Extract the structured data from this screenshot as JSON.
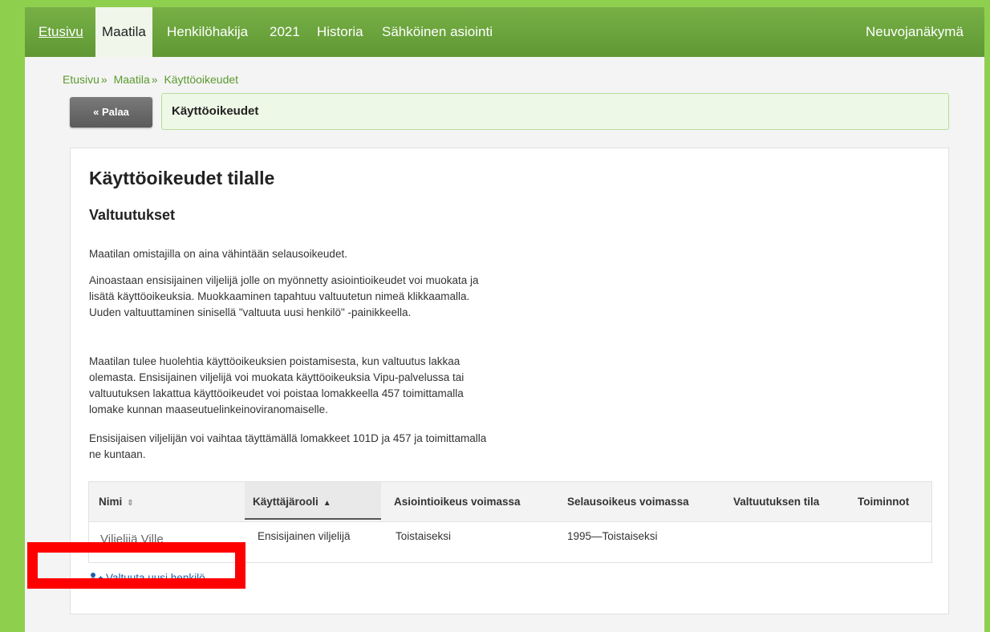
{
  "nav": {
    "items": [
      "Etusivu",
      "Maatila",
      "Henkilöhakija",
      "2021",
      "Historia",
      "Sähköinen asiointi"
    ],
    "right": "Neuvojanäkymä"
  },
  "breadcrumb": [
    "Etusivu",
    "Maatila",
    "Käyttöoikeudet"
  ],
  "back_button": "Palaa",
  "title_bar": "Käyttöoikeudet",
  "page": {
    "heading": "Käyttöoikeudet tilalle",
    "subheading": "Valtuutukset",
    "paragraphs": [
      "Maatilan omistajilla on aina vähintään selausoikeudet.",
      "Ainoastaan ensisijainen viljelijä jolle on myönnetty asiointioikeudet voi muokata ja lisätä käyttöoikeuksia. Muokkaaminen tapahtuu valtuutetun nimeä klikkaamalla. Uuden valtuuttaminen sinisellä \"valtuuta uusi henkilö\" -painikkeella.",
      "Maatilan tulee huolehtia käyttöoikeuksien poistamisesta, kun valtuutus lakkaa olemasta. Ensisijainen viljelijä voi muokata käyttöoikeuksia Vipu-palvelussa tai valtuutuksen lakattua käyttöoikeudet voi poistaa lomakkeella 457 toimittamalla lomake kunnan maaseutuelinkeinoviranomaiselle.",
      "Ensisijaisen viljelijän voi vaihtaa täyttämällä lomakkeet 101D ja 457 ja toimittamalla ne kuntaan."
    ]
  },
  "table": {
    "columns": [
      "Nimi",
      "Käyttäjärooli",
      "Asiointioikeus voimassa",
      "Selausoikeus voimassa",
      "Valtuutuksen tila",
      "Toiminnot"
    ],
    "rows": [
      [
        "Viljelijä Ville",
        "Ensisijainen viljelijä",
        "Toistaiseksi",
        "1995—Toistaiseksi",
        "",
        ""
      ]
    ]
  },
  "add_user_link": "Valtuuta uusi henkilö",
  "colors": {
    "nav_green": "#6aa23f",
    "outer_green": "#8fcf4e",
    "link_blue": "#1f5fa8",
    "highlight_red": "#ff0000"
  }
}
